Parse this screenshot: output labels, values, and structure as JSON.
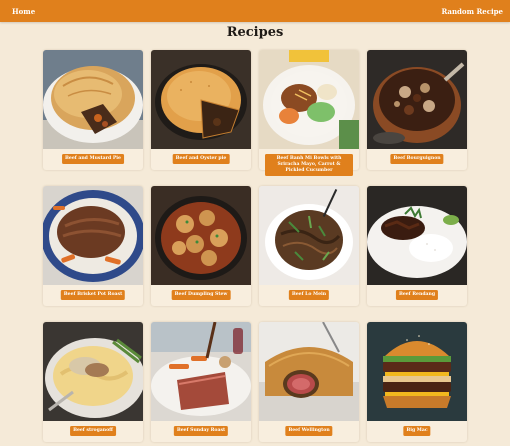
{
  "nav": {
    "home_label": "Home",
    "random_label": "Random Recipe",
    "accent": "#e0801c"
  },
  "page": {
    "title": "Recipes"
  },
  "recipes": [
    {
      "label": "Beef and Mustard Pie",
      "image": "beef-mustard-pie"
    },
    {
      "label": "Beef and Oyster pie",
      "image": "beef-oyster-pie"
    },
    {
      "label": "Beef Banh Mi Bowls with Sriracha Mayo, Carrot & Pickled Cucumber",
      "image": "beef-banh-mi-bowl"
    },
    {
      "label": "Beef Bourguignon",
      "image": "beef-bourguignon"
    },
    {
      "label": "Beef Brisket Pot Roast",
      "image": "beef-brisket-pot-roast"
    },
    {
      "label": "Beef Dumpling Stew",
      "image": "beef-dumpling-stew"
    },
    {
      "label": "Beef Lo Mein",
      "image": "beef-lo-mein"
    },
    {
      "label": "Beef Rendang",
      "image": "beef-rendang"
    },
    {
      "label": "Beef stroganoff",
      "image": "beef-stroganoff"
    },
    {
      "label": "Beef Sunday Roast",
      "image": "beef-sunday-roast"
    },
    {
      "label": "Beef Wellington",
      "image": "beef-wellington"
    },
    {
      "label": "Big Mac",
      "image": "big-mac"
    }
  ]
}
